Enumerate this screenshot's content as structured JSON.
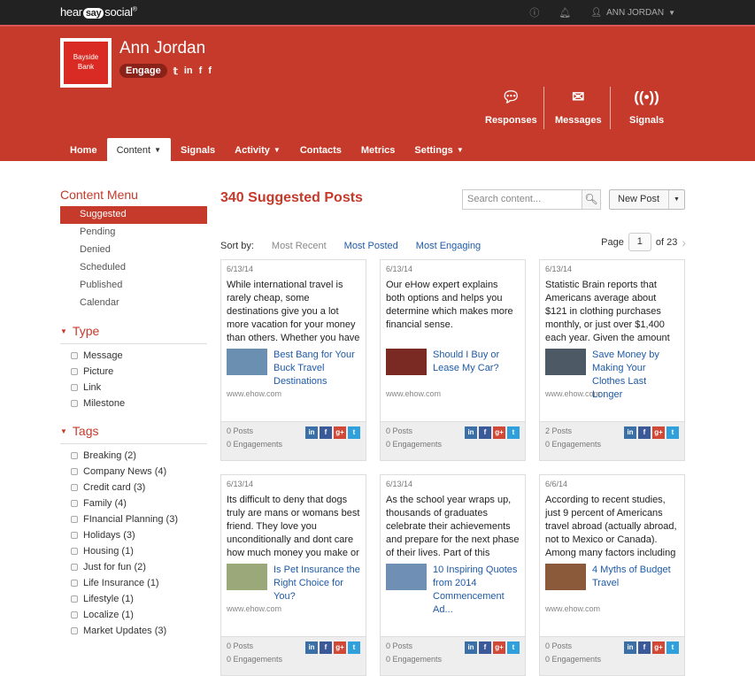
{
  "app": {
    "logo_a": "hear",
    "logo_b": "say",
    "logo_c": "social",
    "logo_mark": "®"
  },
  "topbar": {
    "user": "ANN JORDAN"
  },
  "profile": {
    "brand_line1": "Bayside",
    "brand_line2": "Bank",
    "name": "Ann Jordan",
    "engage": "Engage"
  },
  "quick": {
    "responses": "Responses",
    "messages": "Messages",
    "signals": "Signals"
  },
  "nav": [
    "Home",
    "Content",
    "Signals",
    "Activity",
    "Contacts",
    "Metrics",
    "Settings"
  ],
  "sidebar": {
    "title": "Content Menu",
    "items": [
      "Suggested",
      "Pending",
      "Denied",
      "Scheduled",
      "Published",
      "Calendar"
    ],
    "type_title": "Type",
    "types": [
      "Message",
      "Picture",
      "Link",
      "Milestone"
    ],
    "tags_title": "Tags",
    "tags": [
      "Breaking  (2)",
      "Company News  (4)",
      "Credit card  (3)",
      "Family  (4)",
      "FInancial Planning  (3)",
      "Holidays  (3)",
      "Housing  (1)",
      "Just for fun  (2)",
      "Life Insurance  (1)",
      "Lifestyle  (1)",
      "Localize  (1)",
      "Market Updates  (3)"
    ]
  },
  "main": {
    "title": "340 Suggested Posts",
    "search_placeholder": "Search content...",
    "new_post": "New Post",
    "sort_label": "Sort by:",
    "sort": [
      "Most Recent",
      "Most Posted",
      "Most Engaging"
    ],
    "page_label": "Page",
    "page": "1",
    "of": "of 23"
  },
  "cards": [
    {
      "date": "6/13/14",
      "body": "While international travel is rarely cheap, some destinations give you a lot more vacation for your money than others. Whether you have",
      "title": "Best Bang for Your Buck Travel Destinations",
      "domain": "www.ehow.com",
      "posts": "0 Posts",
      "eng": "0 Engagements",
      "thumb": "#6a8fb0"
    },
    {
      "date": "6/13/14",
      "body": "Our eHow expert explains both options and helps you determine which makes more financial sense.",
      "title": "Should I Buy or Lease My Car?",
      "domain": "www.ehow.com",
      "posts": "0 Posts",
      "eng": "0 Engagements",
      "thumb": "#7a2a22"
    },
    {
      "date": "6/13/14",
      "body": "Statistic Brain reports that Americans average about $121 in clothing purchases monthly, or just over $1,400 each year. Given the amount of money we",
      "title": "Save Money by Making Your Clothes Last Longer",
      "domain": "www.ehow.com",
      "posts": "2 Posts",
      "eng": "0 Engagements",
      "thumb": "#4d5a66"
    },
    {
      "date": "6/13/14",
      "body": "Its difficult to deny that dogs truly are mans or womans best friend. They love you unconditionally and dont care how much money you make or",
      "title": "Is Pet Insurance the Right Choice for You?",
      "domain": "www.ehow.com",
      "posts": "0 Posts",
      "eng": "0 Engagements",
      "thumb": "#9aa87a"
    },
    {
      "date": "6/13/14",
      "body": "As the school year wraps up, thousands of graduates celebrate their achievements and prepare for the next phase of their lives. Part of this annual",
      "title": "10 Inspiring Quotes from 2014 Commencement Ad...",
      "domain": "",
      "posts": "0 Posts",
      "eng": "0 Engagements",
      "thumb": "#6f8fb5"
    },
    {
      "date": "6/6/14",
      "body": "According to recent studies, just 9 percent of Americans travel abroad (actually abroad, not to Mexico or Canada). Among many factors including",
      "title": "4 Myths of Budget Travel",
      "domain": "www.ehow.com",
      "posts": "0 Posts",
      "eng": "0 Engagements",
      "thumb": "#8b5a3a"
    }
  ],
  "colors": {
    "brand": "#c53a2a",
    "link": "#1f5aa6"
  }
}
